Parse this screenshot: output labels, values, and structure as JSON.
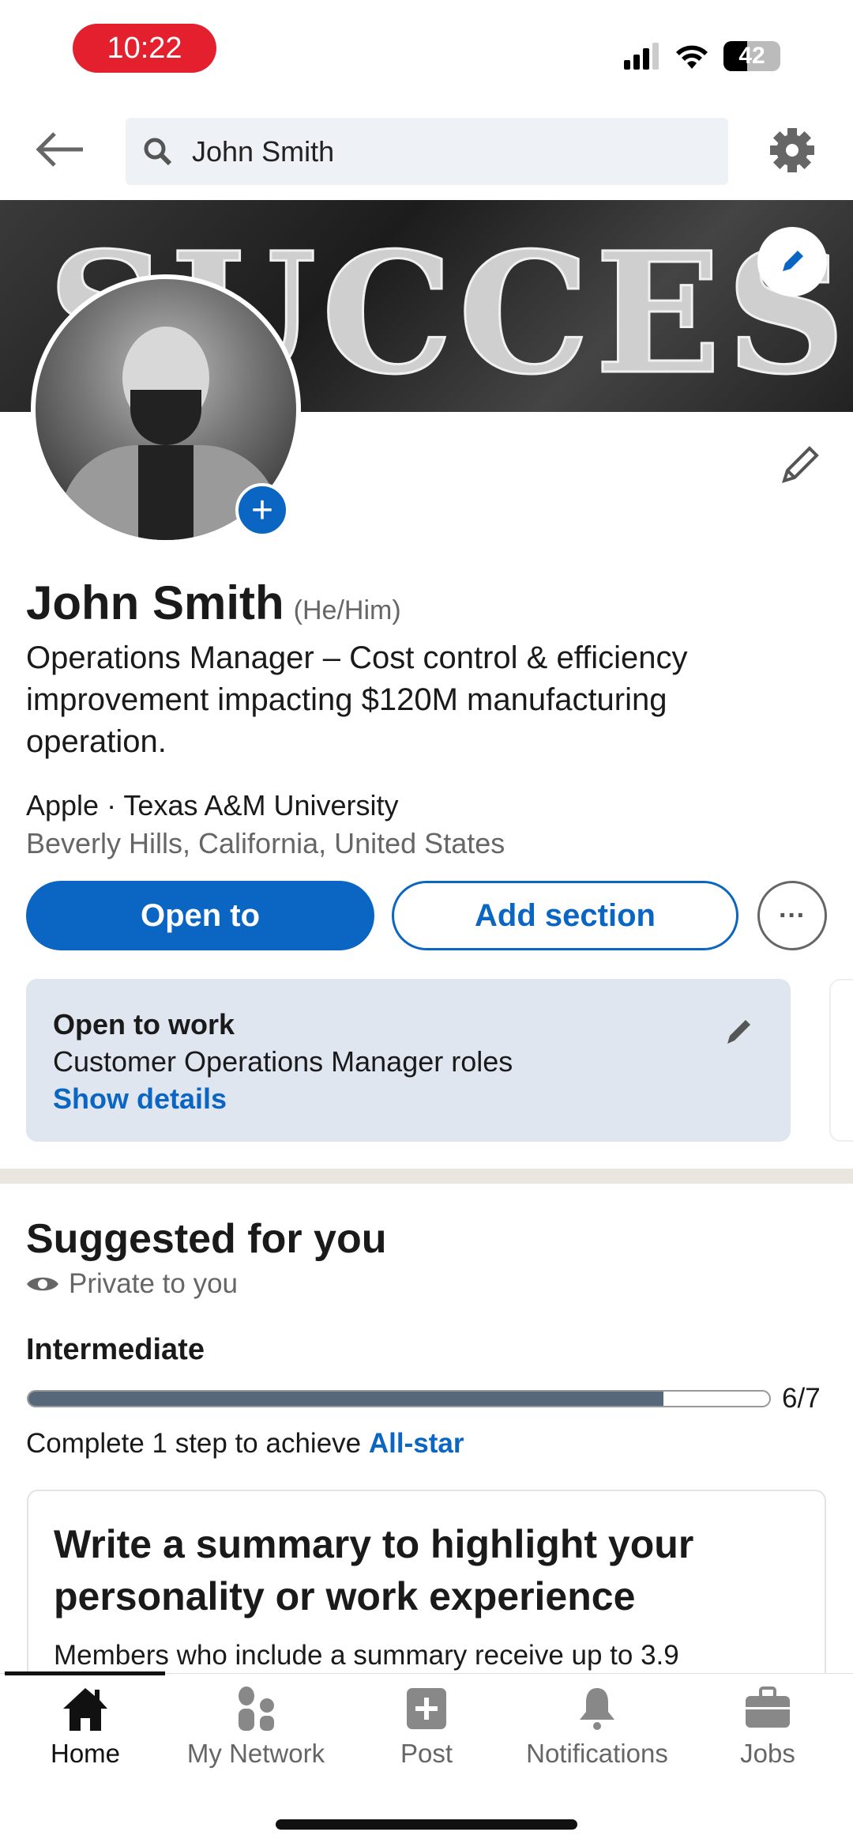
{
  "status_bar": {
    "time": "10:22",
    "battery": "42"
  },
  "header": {
    "search_value": "John Smith"
  },
  "banner": {
    "text": "SUCCESS"
  },
  "profile": {
    "name": "John Smith",
    "pronouns": "(He/Him)",
    "headline": "Operations Manager – Cost control & efficiency improvement impacting $120M manufacturing operation.",
    "company_school": "Apple · Texas A&M University",
    "location": "Beverly Hills, California, United States"
  },
  "actions": {
    "open_to": "Open to",
    "add_section": "Add section",
    "more": "···"
  },
  "open_to_work": {
    "title": "Open to work",
    "roles": "Customer Operations Manager roles",
    "link": "Show details"
  },
  "suggested": {
    "title": "Suggested for you",
    "privacy": "Private to you",
    "level": "Intermediate",
    "progress_label": "6/7",
    "progress": 0.857,
    "complete_prefix": "Complete 1 step to achieve ",
    "complete_link": "All-star",
    "card_title": "Write a summary to highlight your personality or work experience",
    "card_text": "Members who include a summary receive up to 3.9"
  },
  "nav": [
    {
      "label": "Home",
      "icon": "home-icon"
    },
    {
      "label": "My Network",
      "icon": "network-icon"
    },
    {
      "label": "Post",
      "icon": "post-icon"
    },
    {
      "label": "Notifications",
      "icon": "bell-icon"
    },
    {
      "label": "Jobs",
      "icon": "briefcase-icon"
    }
  ],
  "colors": {
    "accent": "#0a66c2",
    "status_pill": "#e5202e",
    "card_bg": "#dfe6f0"
  }
}
